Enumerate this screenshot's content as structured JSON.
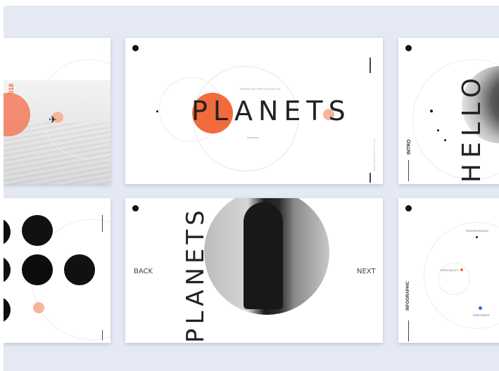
{
  "slides": {
    "s1": {
      "year": "018",
      "accent": "#f27b5a",
      "peach": "#f5b59b"
    },
    "s2": {
      "kicker": "TRENDING PRESENTATION",
      "title": "PLANETS",
      "year": "2019/2018",
      "accent": "#f26b3a",
      "peach": "#f5b59b"
    },
    "s3": {
      "label": "INTRO",
      "word": "HELLO"
    },
    "s4": {
      "peach": "#f5b59b"
    },
    "s5": {
      "back": "BACK",
      "next": "NEXT",
      "word": "PLANETS"
    },
    "s6": {
      "label": "INFOGRAPHIC",
      "professions": "PROFESSIONS",
      "speciality": "SPECIALITY",
      "partners": "PARTNERS",
      "speciality_color": "#f26b3a",
      "partners_color": "#2b6fd6"
    }
  }
}
